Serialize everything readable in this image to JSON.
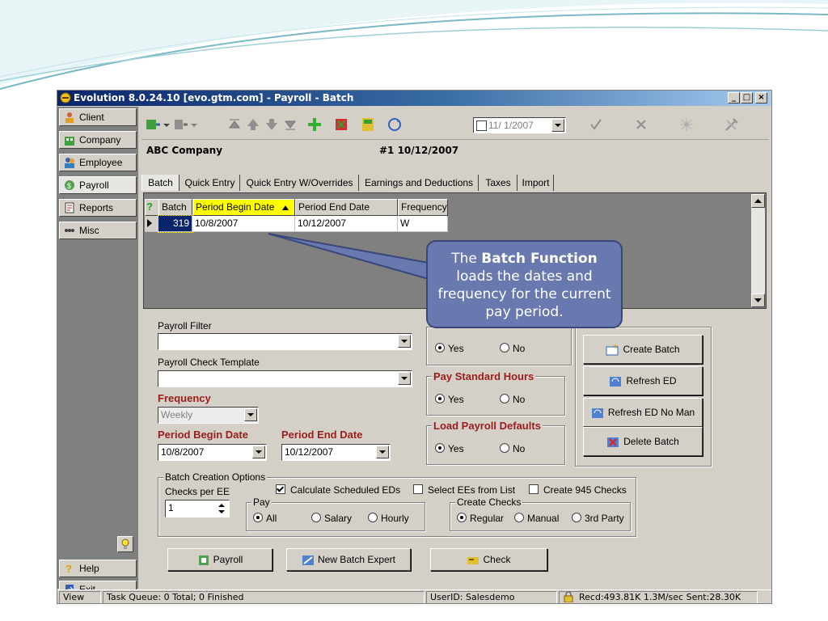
{
  "window": {
    "title": "Evolution 8.0.24.10 [evo.gtm.com] - Payroll - Batch"
  },
  "nav": {
    "client": "Client",
    "company": "Company",
    "employee": "Employee",
    "payroll": "Payroll",
    "reports": "Reports",
    "misc": "Misc",
    "help": "Help",
    "exit": "Exit"
  },
  "toolbar": {
    "date": "11/ 1/2007"
  },
  "header": {
    "company": "ABC Company",
    "batch": "#1 10/12/2007"
  },
  "tabs": [
    "Batch",
    "Quick Entry",
    "Quick Entry W/Overrides",
    "Earnings and Deductions",
    "Taxes",
    "Import"
  ],
  "grid": {
    "columns": [
      "Batch",
      "Period Begin Date",
      "Period End Date",
      "Frequency"
    ],
    "rows": [
      [
        "319",
        "10/8/2007",
        "10/12/2007",
        "W"
      ]
    ]
  },
  "form": {
    "payroll_filter_label": "Payroll Filter",
    "payroll_filter_value": "",
    "check_template_label": "Payroll Check Template",
    "check_template_value": "",
    "frequency_label": "Frequency",
    "frequency_value": "Weekly",
    "period_begin_label": "Period Begin Date",
    "period_begin_value": "10/8/2007",
    "period_end_label": "Period End Date",
    "period_end_value": "10/12/2007"
  },
  "options": {
    "group1": {
      "yes": "Yes",
      "no": "No",
      "selected": "Yes"
    },
    "pay_standard_hours": {
      "title": "Pay Standard Hours",
      "yes": "Yes",
      "no": "No",
      "selected": "Yes"
    },
    "load_payroll_defaults": {
      "title": "Load Payroll Defaults",
      "yes": "Yes",
      "no": "No",
      "selected": "Yes"
    }
  },
  "actions": {
    "create_batch": "Create Batch",
    "refresh_ed": "Refresh ED",
    "refresh_ed_no_man": "Refresh ED No Man",
    "delete_batch": "Delete Batch"
  },
  "batch_creation": {
    "title": "Batch Creation Options",
    "checks_per_ee_label": "Checks per EE",
    "checks_per_ee_value": "1",
    "calc_sched_eds": "Calculate Scheduled EDs",
    "calc_sched_eds_checked": true,
    "select_ees": "Select EEs from List",
    "select_ees_checked": false,
    "create_945": "Create 945 Checks",
    "create_945_checked": false,
    "pay_title": "Pay",
    "pay_all": "All",
    "pay_salary": "Salary",
    "pay_hourly": "Hourly",
    "pay_selected": "All",
    "create_checks_title": "Create Checks",
    "cc_regular": "Regular",
    "cc_manual": "Manual",
    "cc_3rd_party": "3rd Party",
    "cc_selected": "Regular"
  },
  "bottom": {
    "payroll": "Payroll",
    "new_batch_expert": "New Batch Expert",
    "check": "Check"
  },
  "status": {
    "view": "View",
    "task_queue": "Task Queue: 0 Total; 0 Finished",
    "user": "UserID: Salesdemo",
    "transfer": "Recd:493.81K  1.3M/sec  Sent:28.30K"
  },
  "callout": {
    "pre": "The ",
    "bold": "Batch Function",
    "post": " loads the dates and frequency for the current pay period."
  },
  "colors": {
    "title_bar": "#0a246a",
    "highlight": "#ffff00",
    "callout": "#6979b0",
    "label_red": "#9b1c1c"
  }
}
